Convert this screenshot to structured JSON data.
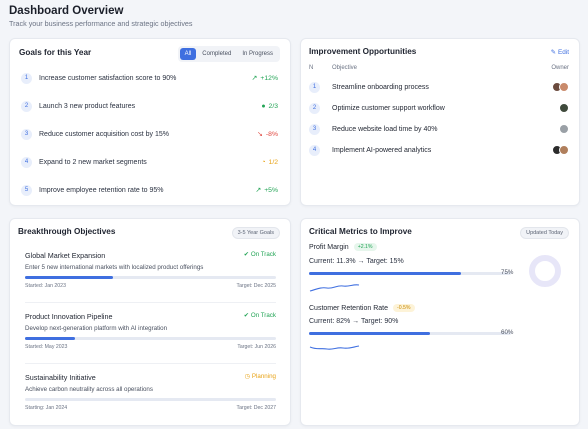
{
  "header": {
    "title": "Dashboard Overview",
    "subtitle": "Track your business performance and strategic objectives"
  },
  "goals": {
    "title": "Goals for this Year",
    "filters": [
      "All",
      "Completed",
      "In Progress"
    ],
    "active_filter": "All",
    "items": [
      {
        "num": "1",
        "text": "Increase customer satisfaction score to 90%",
        "metric": "+12%",
        "icon": "trend-up-icon",
        "glyph": "↗",
        "color": "#22a455"
      },
      {
        "num": "2",
        "text": "Launch 3 new product features",
        "metric": "2/3",
        "icon": "check-circle-icon",
        "glyph": "●",
        "color": "#22a455"
      },
      {
        "num": "3",
        "text": "Reduce customer acquisition cost by 15%",
        "metric": "-8%",
        "icon": "trend-down-icon",
        "glyph": "↘",
        "color": "#e0443c"
      },
      {
        "num": "4",
        "text": "Expand to 2 new market segments",
        "metric": "1/2",
        "icon": "progress-icon",
        "glyph": "◔",
        "color": "#e8a317"
      },
      {
        "num": "5",
        "text": "Improve employee retention rate to 95%",
        "metric": "+5%",
        "icon": "trend-up-icon",
        "glyph": "↗",
        "color": "#22a455"
      }
    ]
  },
  "improvement": {
    "title": "Improvement Opportunities",
    "edit_label": "Edit",
    "columns": {
      "n": "N",
      "objective": "Objective",
      "owner": "Owner"
    },
    "items": [
      {
        "num": "1",
        "text": "Streamline onboarding process",
        "avatars": [
          "#6b4b3e",
          "#c98a6b"
        ]
      },
      {
        "num": "2",
        "text": "Optimize customer support workflow",
        "avatars": [
          "#3f4a3c"
        ]
      },
      {
        "num": "3",
        "text": "Reduce website load time by 40%",
        "avatars": [
          "#9aa0a6"
        ]
      },
      {
        "num": "4",
        "text": "Implement AI-powered analytics",
        "avatars": [
          "#2c2c2c",
          "#b07f5c"
        ]
      }
    ]
  },
  "breakthrough": {
    "title": "Breakthrough Objectives",
    "pill": "3-5 Year Goals",
    "items": [
      {
        "title": "Global Market Expansion",
        "status": "On Track",
        "status_icon": "check-circle-icon",
        "status_color": "#22a455",
        "desc": "Enter 5 new international markets with localized product offerings",
        "progress": 0.35,
        "started": "Started: Jan 2023",
        "target": "Target: Dec 2025"
      },
      {
        "title": "Product Innovation Pipeline",
        "status": "On Track",
        "status_icon": "check-circle-icon",
        "status_color": "#22a455",
        "desc": "Develop next-generation platform with AI integration",
        "progress": 0.2,
        "started": "Started: May 2023",
        "target": "Target: Jun 2026"
      },
      {
        "title": "Sustainability Initiative",
        "status": "Planning",
        "status_icon": "clock-icon",
        "status_color": "#e8a317",
        "desc": "Achieve carbon neutrality across all operations",
        "progress": 0.0,
        "started": "Starting: Jan 2024",
        "target": "Target: Dec 2027"
      }
    ]
  },
  "metrics": {
    "title": "Critical Metrics to Improve",
    "pill": "Updated Today",
    "items": [
      {
        "label": "Profit Margin",
        "badge": "+2.1%",
        "badge_color": "#22a455",
        "badge_bg": "#e6f6ec",
        "current": "Current: 11.3% → Target: 15%",
        "pct_label": "75%",
        "progress": 0.75
      },
      {
        "label": "Customer Retention Rate",
        "badge": "-0.5%",
        "badge_color": "#c98a00",
        "badge_bg": "#fdf3d8",
        "current": "Current: 82% → Target: 90%",
        "pct_label": "60%",
        "progress": 0.6
      }
    ]
  }
}
